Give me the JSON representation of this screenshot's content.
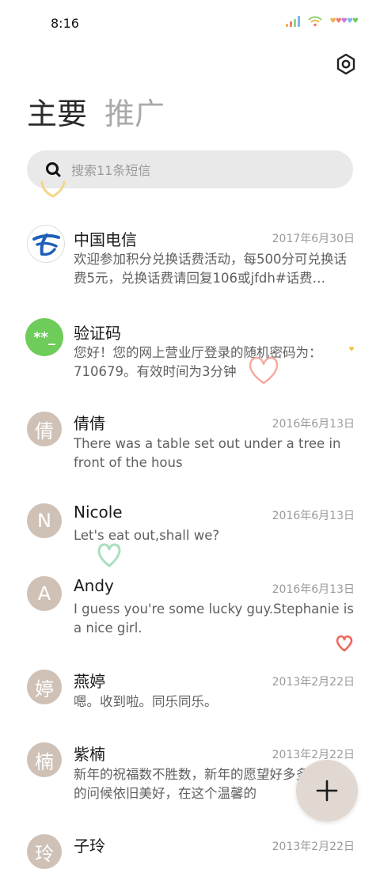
{
  "status": {
    "time": "8:16"
  },
  "tabs": [
    {
      "label": "主要"
    },
    {
      "label": "推广"
    }
  ],
  "search": {
    "placeholder": "搜索11条短信"
  },
  "messages": [
    {
      "name": "中国电信",
      "date": "2017年6月30日",
      "snippet": "欢迎参加积分兑换话费活动，每500分可兑换话费5元，兑换话费请回复106或jfdh#话费…",
      "avatar": "china-telecom-logo"
    },
    {
      "name": "验证码",
      "date": "",
      "snippet": "您好！您的网上营业厅登录的随机密码为：710679。有效时间为3分钟",
      "avatar_text": "**_"
    },
    {
      "name": "倩倩",
      "date": "2016年6月13日",
      "snippet": "There was a table set out under a tree in front of the hous",
      "avatar_text": "倩"
    },
    {
      "name": "Nicole",
      "date": "2016年6月13日",
      "snippet": "Let's eat out,shall we?",
      "avatar_text": "N"
    },
    {
      "name": "Andy",
      "date": "2016年6月13日",
      "snippet": "I guess you're some lucky guy.Stephanie is a nice girl.",
      "avatar_text": "A"
    },
    {
      "name": "燕婷",
      "date": "2013年2月22日",
      "snippet": "嗯。收到啦。同乐同乐。",
      "avatar_text": "婷"
    },
    {
      "name": "紫楠",
      "date": "2013年2月22日",
      "snippet": "新年的祝福数不胜数，新年的愿望好多多，新年的问候依旧美好，在这个温馨的",
      "avatar_text": "楠"
    },
    {
      "name": "子玲",
      "date": "2013年2月22日",
      "snippet": "",
      "avatar_text": "玲"
    }
  ],
  "colors": {
    "accent": "#6dcc5a",
    "avatar_bg": "#cfc1b6",
    "fab_bg": "#e0d8d1"
  }
}
